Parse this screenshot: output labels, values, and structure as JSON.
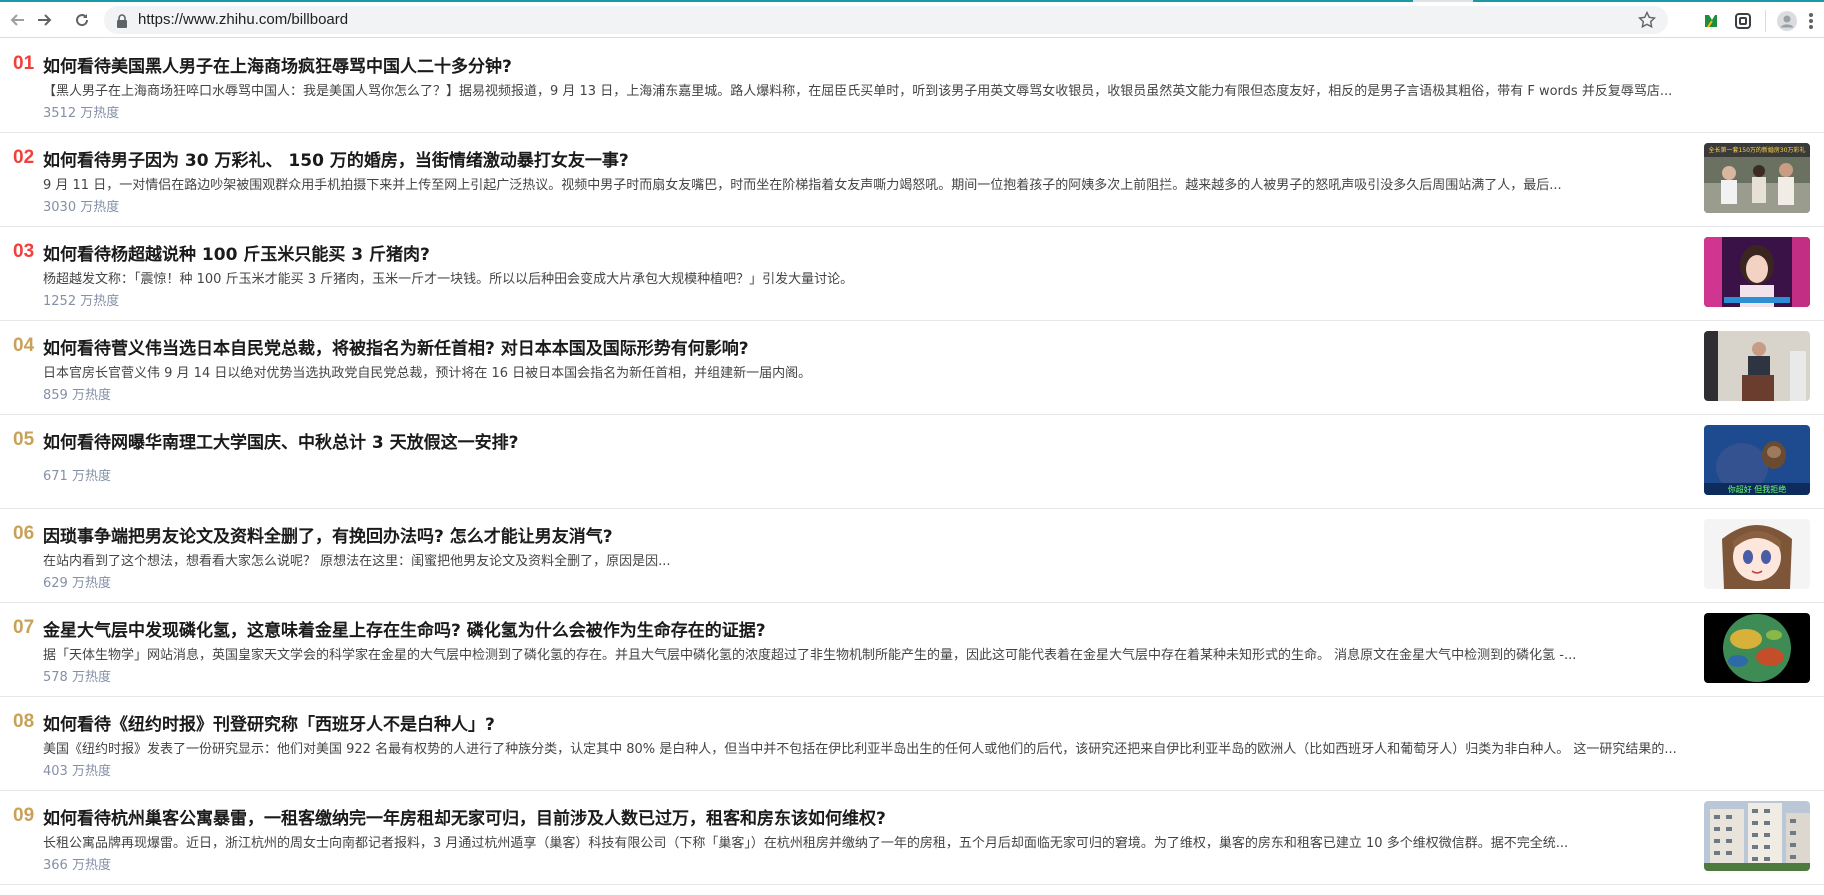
{
  "browser": {
    "url": "https://www.zhihu.com/billboard",
    "back_icon": "arrow-left",
    "forward_icon": "arrow-right",
    "reload_icon": "reload",
    "lock_icon": "lock",
    "star_icon": "star",
    "extensions": [
      "green-leaf-extension",
      "copy-extension",
      "profile-avatar",
      "more-menu"
    ]
  },
  "colors": {
    "rank_top3": "#f1403c",
    "rank_rest": "#c9a25a",
    "heat": "#8590a6"
  },
  "items": [
    {
      "rank": "01",
      "title": "如何看待美国黑人男子在上海商场疯狂辱骂中国人二十多分钟?",
      "excerpt": "【黑人男子在上海商场狂啐口水辱骂中国人：我是美国人骂你怎么了？】据易视频报道，9 月 13 日，上海浦东嘉里城。路人爆料称，在屈臣氏买单时，听到该男子用英文辱骂女收银员，收银员虽然英文能力有限但态度友好，相反的是男子言语极其粗俗，带有 F words 并反复辱骂店...",
      "heat": "3512 万热度",
      "thumb": "none"
    },
    {
      "rank": "02",
      "title": "如何看待男子因为 30 万彩礼、 150 万的婚房，当街情绪激动暴打女友一事?",
      "excerpt": "9 月 11 日，一对情侣在路边吵架被围观群众用手机拍摄下来并上传至网上引起广泛热议。视频中男子时而扇女友嘴巴，时而坐在阶梯指着女友声嘶力竭怒吼。期间一位抱着孩子的阿姨多次上前阻拦。越来越多的人被男子的怒吼声吸引没多久后周围站满了人，最后...",
      "heat": "3030 万热度",
      "thumb": "street-crowd"
    },
    {
      "rank": "03",
      "title": "如何看待杨超越说种 100 斤玉米只能买 3 斤猪肉?",
      "excerpt": "杨超越发文称：「震惊！种 100 斤玉米才能买 3 斤猪肉，玉米一斤才一块钱。所以以后种田会变成大片承包大规模种植吧？」引发大量讨论。",
      "heat": "1252 万热度",
      "thumb": "tv-show"
    },
    {
      "rank": "04",
      "title": "如何看待菅义伟当选日本自民党总裁，将被指名为新任首相? 对日本本国及国际形势有何影响?",
      "excerpt": "日本官房长官菅义伟 9 月 14 日以绝对优势当选执政党自民党总裁，预计将在 16 日被日本国会指名为新任首相，并组建新一届内阁。",
      "heat": "859 万热度",
      "thumb": "press-conference"
    },
    {
      "rank": "05",
      "title": "如何看待网曝华南理工大学国庆、中秋总计 3 天放假这一安排?",
      "excerpt": "",
      "heat": "671 万热度",
      "thumb": "otter"
    },
    {
      "rank": "06",
      "title": "因琐事争端把男友论文及资料全删了，有挽回办法吗? 怎么才能让男友消气?",
      "excerpt": "在站内看到了这个想法，想看看大家怎么说呢？ 原想法在这里：闺蜜把他男友论文及资料全删了，原因是因...",
      "heat": "629 万热度",
      "thumb": "anime-girl"
    },
    {
      "rank": "07",
      "title": "金星大气层中发现磷化氢，这意味着金星上存在生命吗? 磷化氢为什么会被作为生命存在的证据?",
      "excerpt": "据「天体生物学」网站消息，英国皇家天文学会的科学家在金星的大气层中检测到了磷化氢的存在。并且大气层中磷化氢的浓度超过了非生物机制所能产生的量，因此这可能代表着在金星大气层中存在着某种未知形式的生命。 消息原文在金星大气中检测到的磷化氢 -...",
      "heat": "578 万热度",
      "thumb": "venus"
    },
    {
      "rank": "08",
      "title": "如何看待《纽约时报》刊登研究称「西班牙人不是白种人」?",
      "excerpt": "美国《纽约时报》发表了一份研究显示：他们对美国 922 名最有权势的人进行了种族分类，认定其中 80% 是白种人，但当中并不包括在伊比利亚半岛出生的任何人或他们的后代，该研究还把来自伊比利亚半岛的欧洲人（比如西班牙人和葡萄牙人）归类为非白种人。 这一研究结果的...",
      "heat": "403 万热度",
      "thumb": "none"
    },
    {
      "rank": "09",
      "title": "如何看待杭州巢客公寓暴雷，一租客缴纳完一年房租却无家可归，目前涉及人数已过万，租客和房东该如何维权?",
      "excerpt": "长租公寓品牌再现爆雷。近日，浙江杭州的周女士向南都记者报料，3 月通过杭州遁享（巢客）科技有限公司（下称「巢客」）在杭州租房并缴纳了一年的房租，五个月后却面临无家可归的窘境。为了维权，巢客的房东和租客已建立 10 多个维权微信群。据不完全统...",
      "heat": "366 万热度",
      "thumb": "apartment-building"
    }
  ],
  "thumb_overlays": {
    "street": "全长第一套150万的新婚房30万彩礼",
    "otter": "你超好 但我拒绝"
  }
}
